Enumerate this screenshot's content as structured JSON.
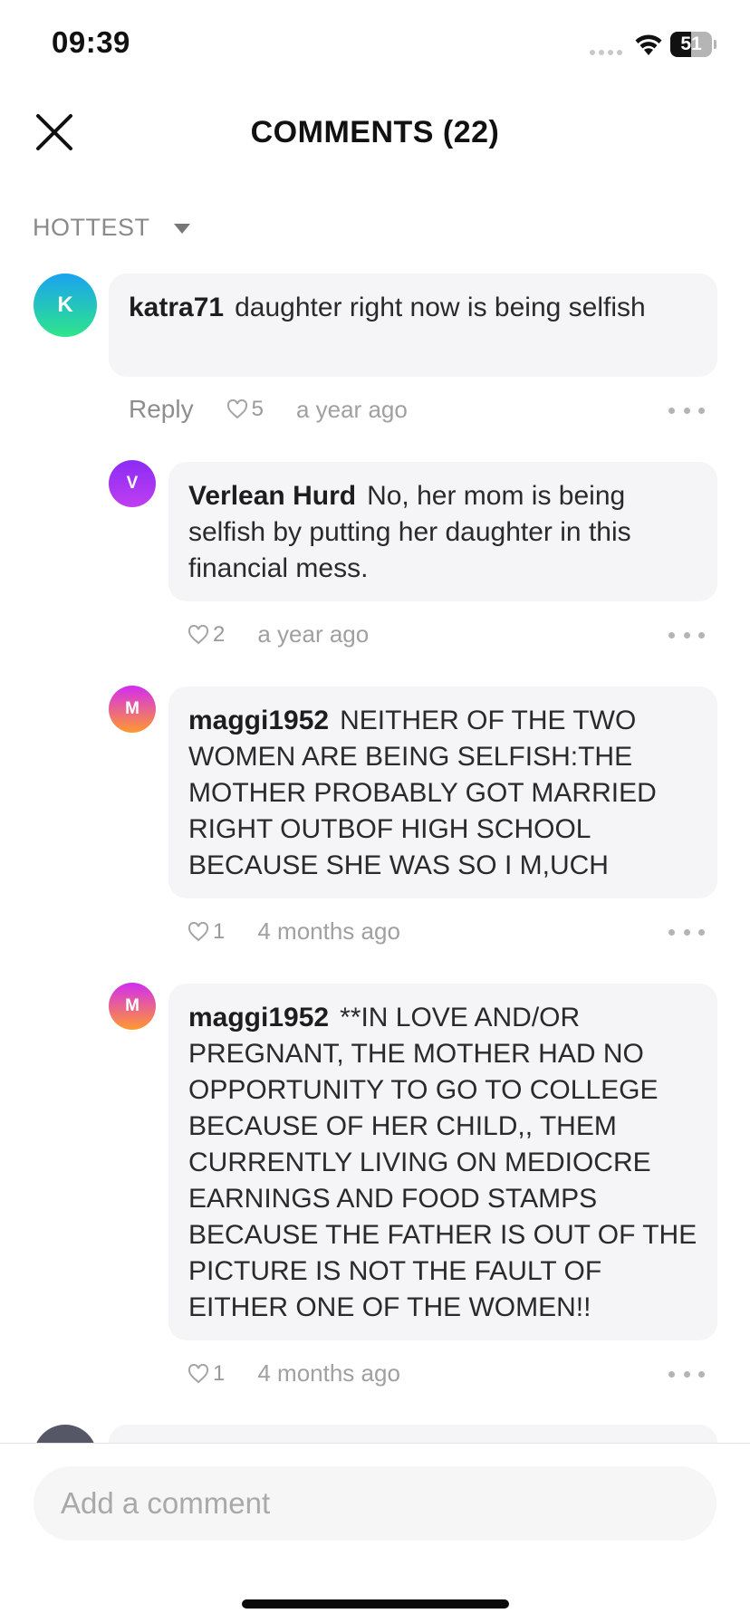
{
  "status_bar": {
    "time": "09:39",
    "battery": "51",
    "battery_fill_fraction": 0.51,
    "icons": [
      "signal-icon",
      "wifi-icon",
      "battery-icon"
    ]
  },
  "header": {
    "title": "COMMENTS (22)",
    "close_icon": "close-icon"
  },
  "sort": {
    "label": "HOTTEST",
    "icon": "caret-down-icon"
  },
  "comments": [
    {
      "avatar_letter": "K",
      "author": "katra71",
      "text": "daughter right now is being selfish",
      "reply_label": "Reply",
      "likes": "5",
      "time": "a year ago",
      "avatar_gradient": [
        "#1aa3f0",
        "#2ee58a"
      ]
    },
    {
      "avatar_letter": "V",
      "author": "Verlean Hurd",
      "text": "No, her mom is being selfish by putting her daughter in this financial mess.",
      "likes": "2",
      "time": "a year ago",
      "avatar_gradient": [
        "#8b2cf5",
        "#c03ef0"
      ]
    },
    {
      "avatar_letter": "M",
      "author": "maggi1952",
      "text": "NEITHER OF THE TWO WOMEN ARE BEING SELFISH:THE MOTHER PROBABLY GOT MARRIED RIGHT OUTBOF HIGH SCHOOL BECAUSE SHE WAS SO   I M,UCH",
      "likes": "1",
      "time": "4 months ago",
      "avatar_gradient": [
        "#d12cf2",
        "#ff9a2e"
      ]
    },
    {
      "avatar_letter": "M",
      "author": "maggi1952",
      "text": "**IN LOVE AND/OR PREGNANT,  THE MOTHER HAD NO OPPORTUNITY TO GO TO COLLEGE BECAUSE OF HER CHILD,, THEM CURRENTLY LIVING ON MEDIOCRE EARNINGS AND FOOD STAMPS BECAUSE THE FATHER IS OUT OF THE PICTURE IS NOT THE FAULT OF EITHER ONE OF THE WOMEN!!",
      "likes": "1",
      "time": "4 months ago",
      "avatar_gradient": [
        "#d12cf2",
        "#ff9a2e"
      ]
    }
  ],
  "composer": {
    "placeholder": "Add a comment"
  }
}
